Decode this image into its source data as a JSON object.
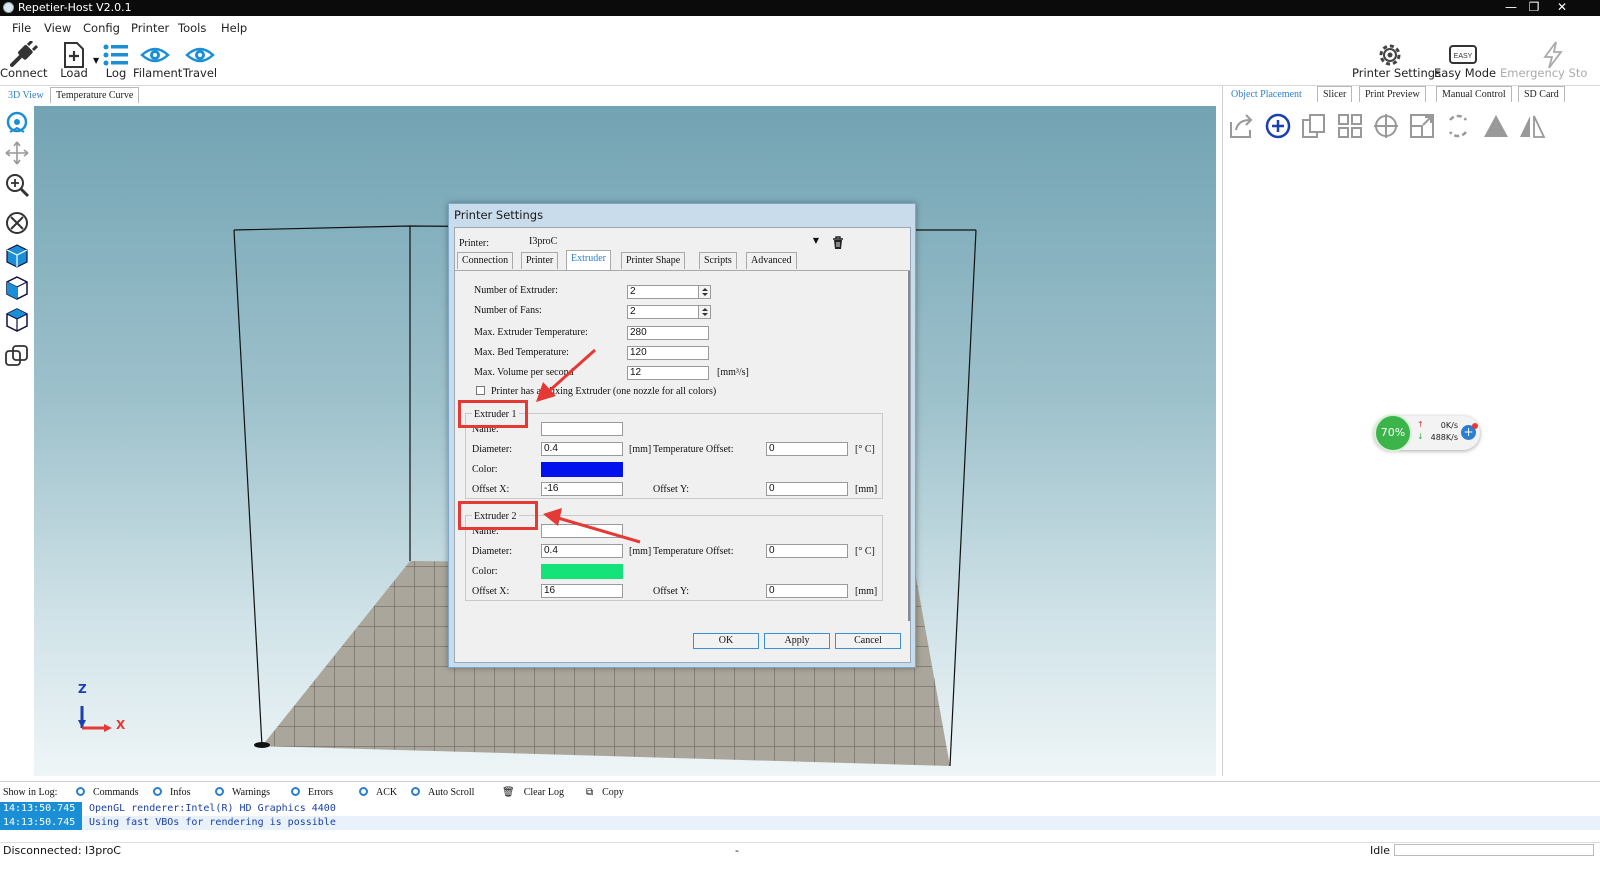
{
  "window": {
    "title": "Repetier-Host V2.0.1"
  },
  "menu": [
    "File",
    "View",
    "Config",
    "Printer",
    "Tools",
    "Help"
  ],
  "toolbar": {
    "connect": "Connect",
    "load": "Load",
    "log": "Log",
    "filament": "Filament",
    "travel": "Travel",
    "printer_settings": "Printer Settings",
    "easy_mode": "Easy Mode",
    "easy_badge": "EASY",
    "emergency": "Emergency Sto"
  },
  "view_tabs": [
    "3D View",
    "Temperature Curve"
  ],
  "right_tabs": [
    "Object Placement",
    "Slicer",
    "Print Preview",
    "Manual Control",
    "SD Card"
  ],
  "axes": {
    "z": "Z",
    "x": "X"
  },
  "net_widget": {
    "percent": "70%",
    "up": "0K/s",
    "down": "488K/s"
  },
  "dialog": {
    "title": "Printer Settings",
    "printer_label": "Printer:",
    "printer_value": "I3proC",
    "tabs": [
      "Connection",
      "Printer",
      "Extruder",
      "Printer Shape",
      "Scripts",
      "Advanced"
    ],
    "fields": {
      "num_extruder_label": "Number of Extruder:",
      "num_extruder": "2",
      "num_fans_label": "Number of Fans:",
      "num_fans": "2",
      "max_extruder_temp_label": "Max. Extruder Temperature:",
      "max_extruder_temp": "280",
      "max_bed_temp_label": "Max. Bed Temperature:",
      "max_bed_temp": "120",
      "max_volume_label": "Max. Volume per second",
      "max_volume": "12",
      "max_volume_unit": "[mm³/s]",
      "mixing_label": "Printer has a Mixing Extruder (one nozzle for all colors)"
    },
    "extruders": [
      {
        "title": "Extruder 1",
        "name_label": "Name:",
        "name": "",
        "diameter_label": "Diameter:",
        "diameter": "0.4",
        "diameter_unit": "[mm]",
        "temp_offset_label": "Temperature Offset:",
        "temp_offset": "0",
        "temp_unit": "[° C]",
        "color_label": "Color:",
        "color": "#0011ee",
        "offset_x_label": "Offset X:",
        "offset_x": "-16",
        "offset_y_label": "Offset Y:",
        "offset_y": "0",
        "offset_unit": "[mm]"
      },
      {
        "title": "Extruder 2",
        "name_label": "Name:",
        "name": "",
        "diameter_label": "Diameter:",
        "diameter": "0.4",
        "diameter_unit": "[mm]",
        "temp_offset_label": "Temperature Offset:",
        "temp_offset": "0",
        "temp_unit": "[° C]",
        "color_label": "Color:",
        "color": "#14e37a",
        "offset_x_label": "Offset X:",
        "offset_x": "16",
        "offset_y_label": "Offset Y:",
        "offset_y": "0",
        "offset_unit": "[mm]"
      }
    ],
    "buttons": {
      "ok": "OK",
      "apply": "Apply",
      "cancel": "Cancel"
    }
  },
  "log": {
    "show_label": "Show in Log:",
    "options": [
      "Commands",
      "Infos",
      "Warnings",
      "Errors",
      "ACK",
      "Auto Scroll"
    ],
    "clear": "Clear Log",
    "copy": "Copy",
    "lines": [
      {
        "time": "14:13:50.745",
        "text": "OpenGL renderer:Intel(R) HD Graphics 4400"
      },
      {
        "time": "14:13:50.745",
        "text": "Using fast VBOs for rendering is possible"
      }
    ]
  },
  "status": {
    "left": "Disconnected: I3proC",
    "mid": "-",
    "right": "Idle"
  },
  "colors": {
    "accent": "#2b7fd3",
    "annotation": "#e53935"
  }
}
